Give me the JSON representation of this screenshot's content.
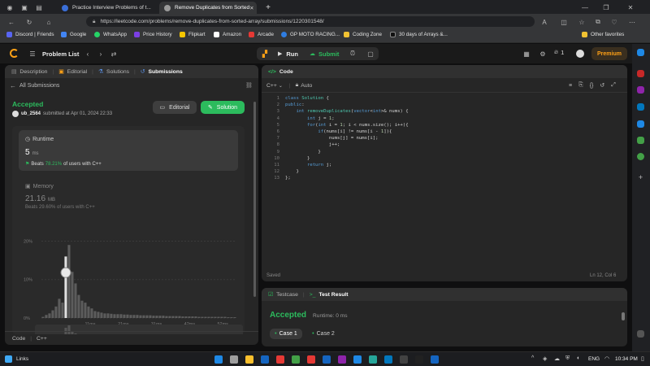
{
  "browser": {
    "tabs": [
      {
        "title": "Practice Interview Problems of t..."
      },
      {
        "title": "Remove Duplicates from Sorted"
      }
    ],
    "url": "https://leetcode.com/problems/remove-duplicates-from-sorted-array/submissions/1220301548/",
    "bookmarks": [
      "Discord | Friends",
      "Google",
      "WhatsApp",
      "Price History",
      "Flipkart",
      "Amazon",
      "Arcade",
      "GP MOTO RACING...",
      "Coding Zone",
      "30 days of Arrays &...",
      "Other favorites"
    ],
    "bookmark_colors": [
      "#5865F2",
      "#4285F4",
      "#25D366",
      "#7b3fe4",
      "#f7c600",
      "#ffffff",
      "#e53935",
      "#2f7de1",
      "#f1c232",
      "#111111",
      "#f1c232"
    ]
  },
  "nav": {
    "problem_list": "Problem List",
    "run": "Run",
    "submit": "Submit",
    "streak": "1",
    "premium": "Premium"
  },
  "left": {
    "tabs": [
      "Description",
      "Editorial",
      "Solutions",
      "Submissions"
    ],
    "back_label": "All Submissions",
    "status": "Accepted",
    "user": "ub_2564",
    "submitted": "submitted at Apr 01, 2024 22:33",
    "editorial_btn": "Editorial",
    "solution_btn": "Solution",
    "runtime_label": "Runtime",
    "runtime_value": "5",
    "runtime_unit": "ms",
    "runtime_beats_prefix": "Beats",
    "runtime_beats": "78.21%",
    "runtime_beats_suffix": "of users with C++",
    "memory_label": "Memory",
    "memory_value": "21.16",
    "memory_unit": "MB",
    "memory_beats": "Beats 29.60% of users with C++",
    "footer_tabs": [
      "Code",
      "C++"
    ]
  },
  "chart_data": {
    "type": "bar",
    "ylabels": [
      "20%",
      "10%",
      "0%"
    ],
    "xlabels": [
      "11ms",
      "21ms",
      "31ms",
      "42ms",
      "52ms"
    ],
    "mini_xlabels": [
      "11ms",
      "21ms",
      "31ms",
      "42ms",
      "52ms"
    ],
    "values": [
      0.3,
      0.8,
      1.2,
      2,
      3,
      5,
      4,
      16,
      19,
      12,
      9,
      6,
      4.5,
      4,
      3,
      2.5,
      1.8,
      1.6,
      1.4,
      1.2,
      1.2,
      1.1,
      1,
      1,
      1,
      0.9,
      0.9,
      0.8,
      0.8,
      0.8,
      0.7,
      0.7,
      0.7,
      0.7,
      0.6,
      0.6,
      0.6,
      0.6,
      0.5,
      0.5,
      0.5,
      0.5,
      0.5,
      0.4,
      0.4,
      0.4,
      0.4,
      0.4,
      0.3,
      0.3,
      0.3,
      0.3,
      0.3,
      0.3,
      0.3,
      0.3,
      0.3,
      0.2,
      0.2,
      0.2
    ],
    "highlight_index": 7,
    "ylim": [
      0,
      22
    ]
  },
  "editor": {
    "title": "Code",
    "language": "C++",
    "mode": "Auto",
    "line_numbers": [
      "1",
      "2",
      "3",
      "4",
      "5",
      "6",
      "7",
      "8",
      "9",
      "10",
      "11",
      "12",
      "13"
    ],
    "lines": [
      "class Solution {",
      "public:",
      "    int removeDuplicates(vector<int>& nums) {",
      "        int j = 1;",
      "        for(int i = 1; i < nums.size(); i++){",
      "            if(nums[i] != nums[i - 1]){",
      "                nums[j] = nums[i];",
      "                j++;",
      "            }",
      "        }",
      "        return j;",
      "    }",
      "};"
    ],
    "saved": "Saved",
    "cursor": "Ln 12, Col 6"
  },
  "result": {
    "tab_testcase": "Testcase",
    "tab_result": "Test Result",
    "status": "Accepted",
    "runtime": "Runtime: 0 ms",
    "cases": [
      "Case 1",
      "Case 2"
    ]
  },
  "taskbar": {
    "start_label": "Links",
    "lang": "ENG",
    "time": "10:34 PM",
    "icons": [
      "#1e88e5",
      "#9e9e9e",
      "#fbc02d",
      "#1565c0",
      "#e53935",
      "#43a047",
      "#e53935",
      "#1565c0",
      "#8e24aa",
      "#1e88e5",
      "#26a69a",
      "#0277bd",
      "#424242",
      "#212121",
      "#1565c0"
    ]
  },
  "colors": {
    "accent_green": "#2cbb5d",
    "accent_orange": "#ffa116",
    "premium": "#ffa116"
  }
}
